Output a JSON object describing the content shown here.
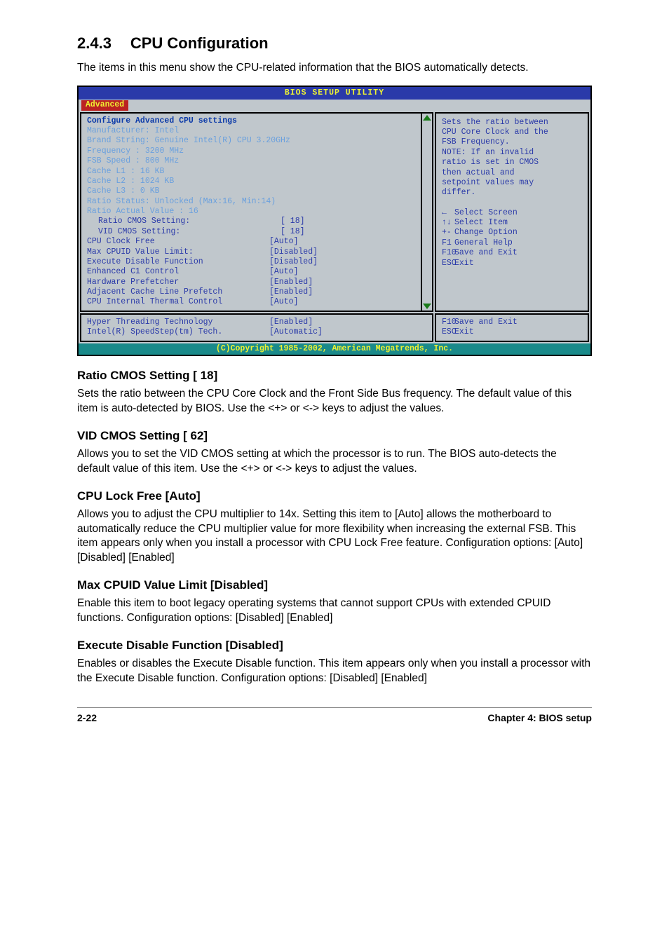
{
  "section": {
    "number": "2.4.3",
    "title": "CPU Configuration"
  },
  "intro": "The items in this menu show the CPU-related information that the BIOS automatically detects.",
  "bios": {
    "header": "BIOS SETUP UTILITY",
    "tab": "Advanced",
    "headline": "Configure Advanced CPU settings",
    "info": {
      "manufacturer": "Manufacturer: Intel",
      "brand": "Brand String: Genuine Intel(R) CPU 3.20GHz",
      "frequency": "Frequency   : 3200 MHz",
      "fsb": "FSB Speed   : 800 MHz",
      "l1": "Cache L1    : 16 KB",
      "l2": "Cache L2    : 1024 KB",
      "l3": "Cache L3    : 0 KB",
      "ratio_status": "Ratio Status: Unlocked (Max:16, Min:14)",
      "ratio_actual": "Ratio Actual Value : 16"
    },
    "settings": [
      {
        "label": "Ratio CMOS Setting:",
        "value": "[ 18]",
        "indent": true
      },
      {
        "label": "VID CMOS Setting:",
        "value": "[ 18]",
        "indent": true
      },
      {
        "label": "CPU Clock Free",
        "value": "[Auto]",
        "indent": false
      },
      {
        "label": "Max CPUID Value Limit:",
        "value": "[Disabled]",
        "indent": false
      },
      {
        "label": "Execute Disable Function",
        "value": "[Disabled]",
        "indent": false
      },
      {
        "label": "Enhanced C1 Control",
        "value": "[Auto]",
        "indent": false
      },
      {
        "label": "Hardware Prefetcher",
        "value": "[Enabled]",
        "indent": false
      },
      {
        "label": "Adjacent Cache Line Prefetch",
        "value": "[Enabled]",
        "indent": false
      },
      {
        "label": "CPU Internal Thermal Control",
        "value": "[Auto]",
        "indent": false
      }
    ],
    "bottom_settings": [
      {
        "label": "Hyper Threading Technology",
        "value": "[Enabled]"
      },
      {
        "label": "Intel(R) SpeedStep(tm) Tech.",
        "value": "[Automatic]"
      }
    ],
    "help": {
      "desc_lines": [
        "Sets the ratio between",
        "CPU Core Clock and the",
        "FSB Frequency.",
        "NOTE: If an invalid",
        "ratio is set in CMOS",
        "then actual and",
        "setpoint values may",
        "differ."
      ],
      "nav": [
        {
          "glyph": "←",
          "text": "Select Screen"
        },
        {
          "glyph": "↑↓",
          "text": "Select Item"
        },
        {
          "glyph": "+-",
          "text": "Change Option"
        },
        {
          "glyph": "F1",
          "text": "General Help"
        },
        {
          "glyph": "F10",
          "text": "Save and Exit"
        },
        {
          "glyph": "ESC",
          "text": "Exit"
        }
      ],
      "nav_bottom": [
        {
          "glyph": "F10",
          "text": "Save and Exit"
        },
        {
          "glyph": "ESC",
          "text": "Exit"
        }
      ]
    },
    "copyright": "(C)Copyright 1985-2002, American Megatrends, Inc."
  },
  "items": {
    "ratio": {
      "head": "Ratio CMOS Setting [ 18]",
      "body": "Sets the ratio between the CPU Core Clock and the Front Side Bus frequency. The default value of this item is auto-detected by BIOS. Use the <+> or <-> keys to adjust the values."
    },
    "vid": {
      "head": "VID CMOS Setting [ 62]",
      "body": "Allows you to set the VID CMOS setting at which the processor is to run. The BIOS auto-detects the default value of this item. Use the <+> or <-> keys to adjust the values."
    },
    "lockfree": {
      "head": "CPU Lock Free [Auto]",
      "body": "Allows you to adjust the CPU multiplier to 14x. Setting this item to [Auto] allows the motherboard to automatically reduce the CPU multiplier value for more flexibility when increasing the external FSB. This item appears only when you install a processor with CPU Lock Free feature. Configuration options: [Auto] [Disabled] [Enabled]"
    },
    "cpuid": {
      "head": "Max CPUID Value Limit [Disabled]",
      "body": "Enable this item to boot legacy operating systems that cannot support CPUs with extended CPUID functions. Configuration options: [Disabled] [Enabled]"
    },
    "xd": {
      "head": "Execute Disable Function [Disabled]",
      "body": "Enables or disables the Execute Disable function. This item appears only when you install a processor with the Execute Disable function. Configuration options: [Disabled] [Enabled]"
    }
  },
  "footer": {
    "left": "2-22",
    "right": "Chapter 4: BIOS setup"
  }
}
